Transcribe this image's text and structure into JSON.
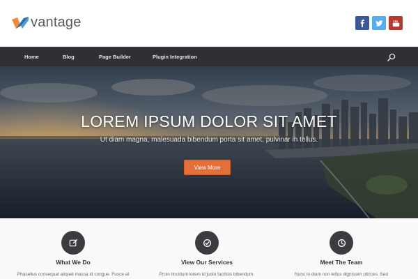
{
  "brand": {
    "name": "vantage",
    "logo_colors": [
      "#f08a3c",
      "#2e6ea8",
      "#4f9ad6"
    ]
  },
  "socials": [
    {
      "name": "facebook",
      "icon": "facebook-icon",
      "color": "#3b5998"
    },
    {
      "name": "twitter",
      "icon": "twitter-icon",
      "color": "#55acee"
    },
    {
      "name": "youtube",
      "icon": "youtube-icon",
      "color": "#b8372f"
    }
  ],
  "nav": {
    "items": [
      {
        "label": "Home"
      },
      {
        "label": "Blog"
      },
      {
        "label": "Page Builder"
      },
      {
        "label": "Plugin Integration"
      }
    ],
    "search_icon": "search-icon"
  },
  "hero": {
    "title": "LOREM IPSUM DOLOR SIT AMET",
    "subtitle": "Ut diam magna, malesuada bibendum porta sit amet, pulvinar in tellus.",
    "button_label": "View More",
    "button_color": "#e36f3b"
  },
  "features": [
    {
      "icon": "edit-icon",
      "title": "What We Do",
      "text": "Phasellus consequat aliquet massa id congue. Fusce at"
    },
    {
      "icon": "check-circle-icon",
      "title": "View Our Services",
      "text": "Proin tincidunt lorem id justo facilisis bibendum."
    },
    {
      "icon": "clock-icon",
      "title": "Meet The Team",
      "text": "Nunc in diam non tellus dignissim ultrices. Sed"
    }
  ]
}
